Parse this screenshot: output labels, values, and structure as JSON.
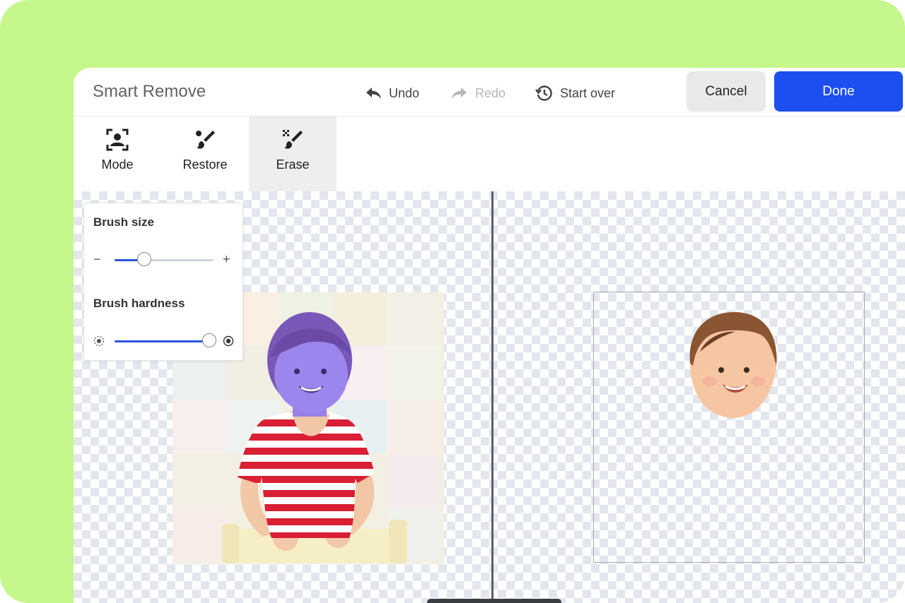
{
  "header": {
    "title": "Smart Remove",
    "undo_label": "Undo",
    "redo_label": "Redo",
    "start_over_label": "Start over",
    "cancel_label": "Cancel",
    "done_label": "Done"
  },
  "tools": [
    {
      "label": "Mode",
      "icon": "person-focus-icon",
      "active": false
    },
    {
      "label": "Restore",
      "icon": "restore-brush-icon",
      "active": false
    },
    {
      "label": "Erase",
      "icon": "erase-brush-icon",
      "active": true
    }
  ],
  "brush_panel": {
    "size_label": "Brush size",
    "size_minus": "−",
    "size_plus": "+",
    "size_value": 0.3,
    "hardness_label": "Brush hardness",
    "hardness_value": 0.96
  },
  "colors": {
    "accent": "#1d4ff0",
    "background": "#c5f78c",
    "erase_overlay": "#7a5cf0"
  }
}
